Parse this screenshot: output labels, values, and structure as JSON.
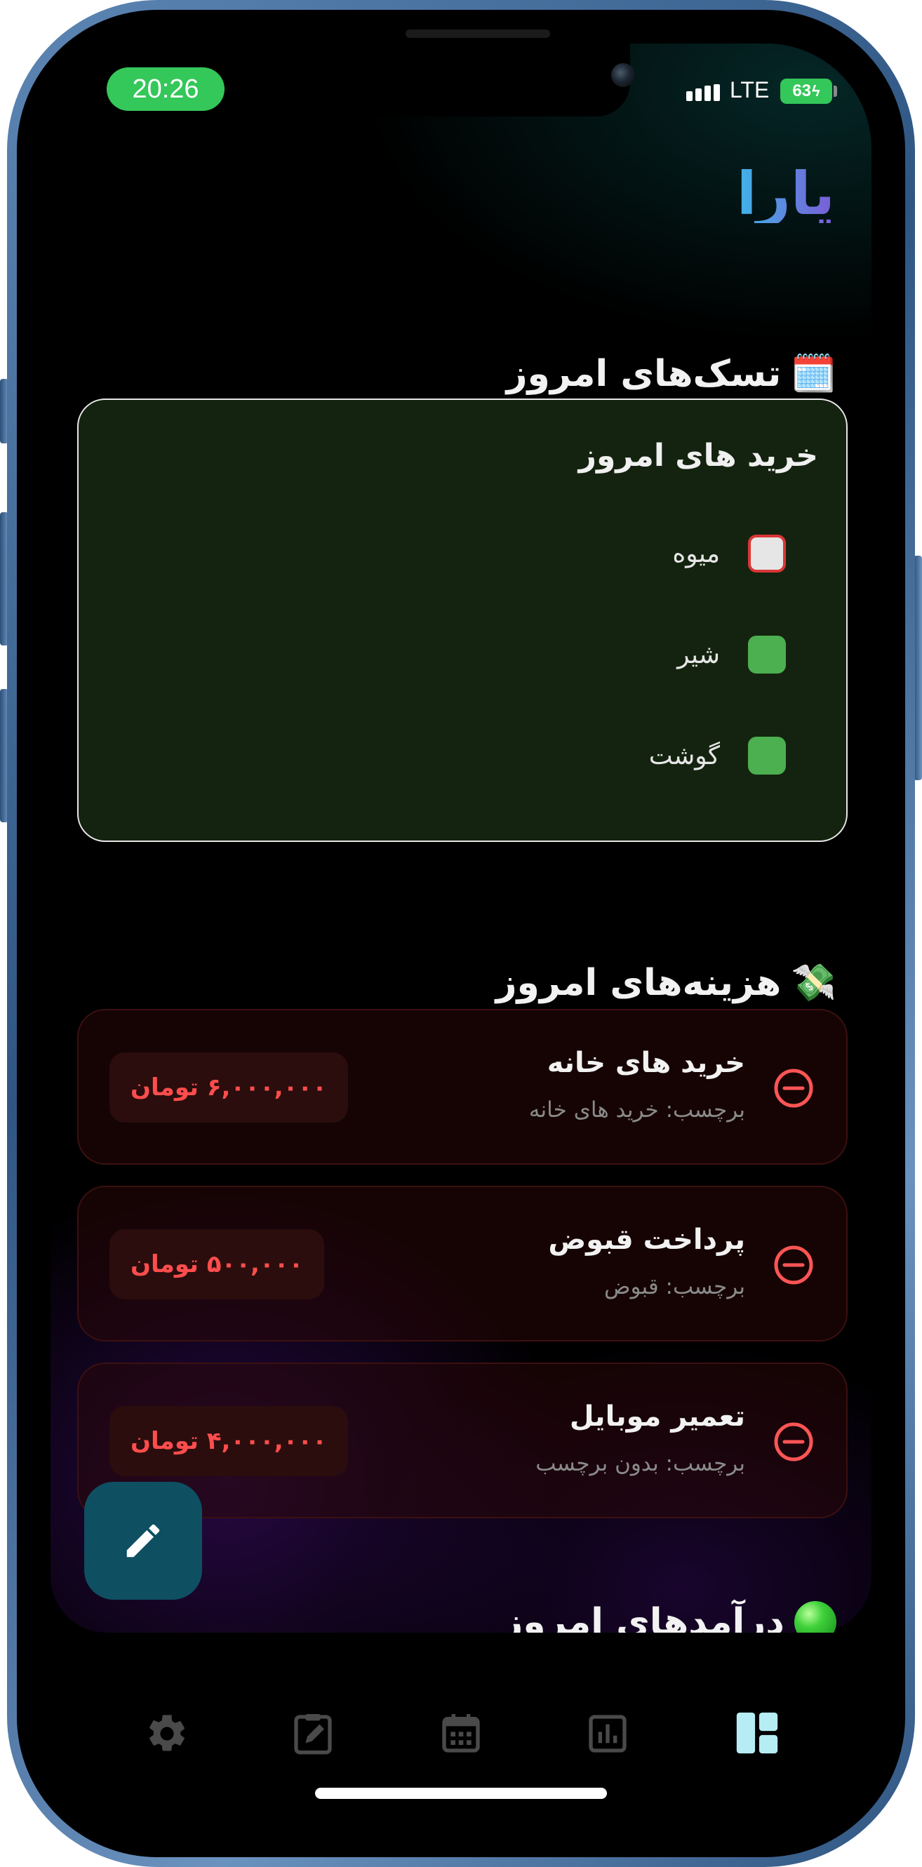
{
  "status_bar": {
    "time": "20:26",
    "network": "LTE",
    "battery": "63"
  },
  "app": {
    "title": "یارا"
  },
  "tasks_section": {
    "emoji": "🗓️",
    "title": "تسک‌های امروز",
    "card_title": "خرید های امروز",
    "items": [
      {
        "label": "میوه",
        "checked": false
      },
      {
        "label": "شیر",
        "checked": true
      },
      {
        "label": "گوشت",
        "checked": true
      }
    ]
  },
  "expenses_section": {
    "emoji": "💸",
    "title": "هزینه‌های امروز",
    "items": [
      {
        "title": "خرید های خانه",
        "tag": "برچسب: خرید های خانه",
        "amount": "۶,۰۰۰,۰۰۰ تومان"
      },
      {
        "title": "پرداخت قبوض",
        "tag": "برچسب: قبوض",
        "amount": "۵۰۰,۰۰۰ تومان"
      },
      {
        "title": "تعمیر موبایل",
        "tag": "برچسب: بدون برچسب",
        "amount": "۴,۰۰۰,۰۰۰ تومان"
      }
    ]
  },
  "income_section": {
    "title": "درآمدهای امروز"
  },
  "nav": {
    "items": [
      "settings-icon",
      "edit-clipboard-icon",
      "calendar-icon",
      "chart-icon",
      "dashboard-icon"
    ],
    "active": "dashboard-icon",
    "colors": {
      "active": "#b6ecf3",
      "inactive": "#4a4a4a"
    }
  },
  "colors": {
    "accent_green": "#4caf50",
    "expense_red": "#ff4d4d",
    "fab": "#0e4f62"
  }
}
